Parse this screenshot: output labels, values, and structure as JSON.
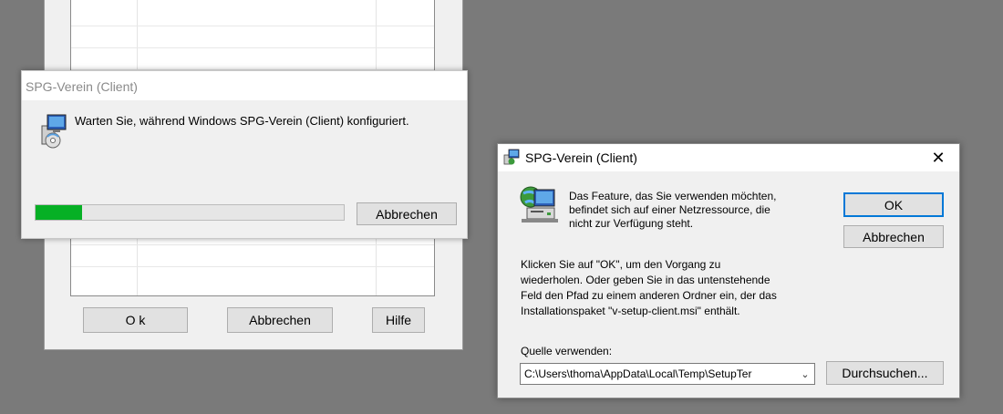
{
  "background_dialog": {
    "buttons": {
      "ok": "O k",
      "cancel": "Abbrechen",
      "help": "Hilfe"
    }
  },
  "progress_dialog": {
    "title": "SPG-Verein (Client)",
    "message": "Warten Sie, während Windows SPG-Verein (Client) konfiguriert.",
    "progress_fraction": 0.15,
    "cancel_label": "Abbrechen"
  },
  "source_dialog": {
    "title": "SPG-Verein (Client)",
    "close_glyph": "✕",
    "message_lines": [
      "Das Feature, das Sie verwenden möchten,",
      "befindet sich auf einer Netzressource, die",
      "nicht zur Verfügung steht."
    ],
    "instructions_lines": [
      "Klicken Sie auf \"OK\", um den Vorgang zu",
      "wiederholen. Oder geben Sie in das untenstehende",
      "Feld den Pfad zu einem anderen Ordner ein, der das",
      "Installationspaket \"v-setup-client.msi\" enthält."
    ],
    "ok_label": "OK",
    "cancel_label": "Abbrechen",
    "source_label": "Quelle verwenden:",
    "source_value": "C:\\Users\\thoma\\AppData\\Local\\Temp\\SetupTer",
    "browse_label": "Durchsuchen..."
  },
  "colors": {
    "progress_fill": "#06b025",
    "default_button_border": "#0078d7"
  },
  "icons": {
    "installer": "installer-icon",
    "network": "network-drive-icon",
    "close": "close-icon",
    "dropdown": "chevron-down-icon"
  }
}
